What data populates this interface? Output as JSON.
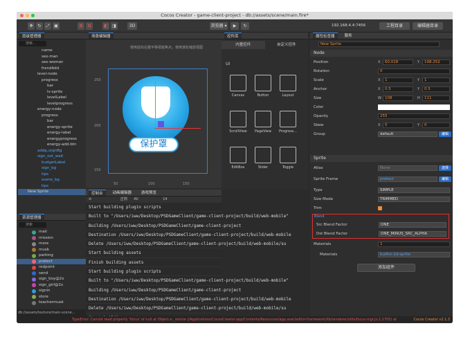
{
  "window": {
    "title": "Cocos Creator - game-client-project - db://assets/scene/main.fire*"
  },
  "toolbar": {
    "browser": "浏览器",
    "ip": "192.168.4.4:7456",
    "project": "工程目录",
    "editor": "编辑器目录"
  },
  "hierarchy": {
    "title": "层级管理器",
    "search_placeholder": "搜索...",
    "items": [
      "name",
      "sex-man",
      "sex-woman",
      "frendAdd",
      "level-node",
      "progress",
      "bar",
      "lv-sprite",
      "levelLabel",
      "levelprogress",
      "energy-node",
      "progress",
      "bar",
      "energy-sprite",
      "energy-label",
      "energyprogress",
      "energy-add-btn",
      "addp,urgnBg",
      "sign_oot_wait",
      "budgetLabel",
      "sign_bg",
      "tips",
      "scene_bg",
      "tips",
      "New Sprite"
    ]
  },
  "assets": {
    "title": "资源管理器",
    "search_placeholder": "搜索",
    "items": [
      "mail",
      "mission",
      "more",
      "musk",
      "parking",
      "protect",
      "redpoint",
      "send",
      "sign_boy@2x",
      "sign_girl@2x",
      "signin",
      "store",
      "teachermusk"
    ],
    "path": "db://assets/texture/main-scene..."
  },
  "scene": {
    "title": "场景编辑器",
    "hint": "使用鼠标右键平移视窗焦点，使用滚轮缩放视图",
    "label_text": "保护罩",
    "ticks": [
      "250",
      "200",
      "150",
      "50",
      "100",
      "150"
    ]
  },
  "widgets": {
    "title": "控件库",
    "tab1": "内置控件",
    "tab2": "自定义控件",
    "ui_label": "UI",
    "items": [
      "Canvas",
      "Button",
      "Layout",
      "ScrollView",
      "PageView",
      "Progress...",
      "EditBox",
      "Slider",
      "Toggle"
    ],
    "top_labels": [
      "RichText",
      "Particles...",
      "TiledMap"
    ]
  },
  "console": {
    "tabs": [
      "控制台",
      "动画编辑器",
      "游戏预览"
    ],
    "level": "All",
    "regex": "正则",
    "font": "14",
    "lines": [
      "Start building plugin scripts",
      "Built to \"/Users/iww/Desktop/PSDGameClient/game-client-project/build/web-mobile\"",
      "Building /Users/iww/Desktop/PSDGameClient/game-client-project",
      "Destination /Users/iww/Desktop/PSDGameClient/game-client-project/build/web-mobile",
      "Delete /Users/iww/Desktop/PSDGameClient/game-client-project/build/web-mobile/su",
      "Start building assets",
      "Finish building assets",
      "Start building plugin scripts",
      "Built to \"/Users/iww/Desktop/PSDGameClient/game-client-project/build/web-mobile\"",
      "Building /Users/iww/Desktop/PSDGameClient/game-client-project",
      "Destination /Users/iww/Desktop/PSDGameClient/game-client-project/build/web-mobile",
      "Delete /Users/iww/Desktop/PSDGameClient/game-client-project/build/web-mobile/su",
      "Start building assets"
    ]
  },
  "props": {
    "tab1": "属性检查器",
    "tab2": "服务",
    "node_name": "New Sprite",
    "node_section": "Node",
    "position": {
      "label": "Position",
      "x": "60.018",
      "y": "198.252"
    },
    "rotation": {
      "label": "Rotation",
      "v": "0"
    },
    "scale": {
      "label": "Scale",
      "x": "1",
      "y": "1"
    },
    "anchor": {
      "label": "Anchor",
      "x": "0.5",
      "y": "0.5"
    },
    "size": {
      "label": "Size",
      "w": "108",
      "h": "111"
    },
    "color": {
      "label": "Color"
    },
    "opacity": {
      "label": "Opacity",
      "v": "255"
    },
    "skew": {
      "label": "Skew",
      "x": "0",
      "y": "0"
    },
    "group": {
      "label": "Group",
      "v": "default",
      "btn": "编辑"
    },
    "sprite_section": "Sprite",
    "atlas": {
      "label": "Atlas",
      "tag": "sprite-atlas",
      "v": "None",
      "btn": "选择"
    },
    "frame": {
      "label": "Sprite Frame",
      "tag": "sprite-frame",
      "v": "protect",
      "btn": "编辑"
    },
    "type": {
      "label": "Type",
      "v": "SIMPLE"
    },
    "sizemode": {
      "label": "Size Mode",
      "v": "TRIMMED"
    },
    "trim": {
      "label": "Trim"
    },
    "blend": {
      "label": "Blend",
      "src_label": "Src Blend Factor",
      "src": "ONE",
      "dst_label": "Dst Blend Factor",
      "dst": "ONE_MINUS_SRC_ALPHA"
    },
    "materials": {
      "label": "Materials",
      "count": "1",
      "sub": "Materials",
      "tag": "material",
      "v": "builtin-2d-sprite"
    },
    "add_component": "添加组件"
  },
  "statusbar": {
    "error": "TypeError: Cannot read property 'focus' of null at Object.e._reisize (/Applications/CocosCreator.app/Contents/Resources/app.asar/editor-framework/lib/renderer/utils/focus-mgr.js:1:1705) at",
    "version": "Cocos Creator v2.1.3"
  }
}
